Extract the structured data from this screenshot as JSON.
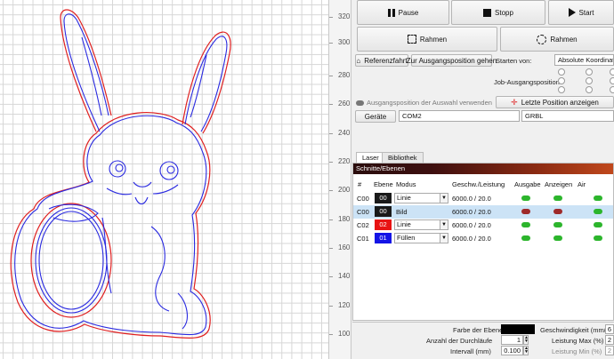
{
  "toolbar": {
    "pause_label": "Pause",
    "stop_label": "Stopp",
    "start_label": "Start",
    "frame_label": "Rahmen",
    "frame_round_label": "Rahmen"
  },
  "position": {
    "reference_label": "Referenzfahrt",
    "home_label": "Zur Ausgangsposition gehen",
    "start_from_label": "Starten von:",
    "start_from_value": "Absolute Koordinaten",
    "job_origin_label": "Job-Ausgangsposition",
    "use_selection_label": "Ausgangsposition der Auswahl verwenden",
    "last_position_label": "Letzte Position anzeigen",
    "device_button_label": "Geräte",
    "port_value": "COM2",
    "controller_value": "GRBL"
  },
  "ruler": {
    "ticks": [
      "320",
      "300",
      "280",
      "260",
      "240",
      "220",
      "200",
      "180",
      "160",
      "140",
      "120",
      "100"
    ]
  },
  "tabs": [
    {
      "label": "Laser"
    },
    {
      "label": "Bibliothek"
    }
  ],
  "layers": {
    "title": "Schnitte/Ebenen",
    "headers": {
      "num": "#",
      "layer": "Ebene",
      "mode": "Modus",
      "speed_power": "Geschw./Leistung",
      "output": "Ausgabe",
      "show": "Anzeigen",
      "air": "Air"
    },
    "rows": [
      {
        "num": "C00",
        "layer": "00",
        "color": "#1a1a1a",
        "mode": "Linie",
        "has_dropdown": true,
        "speed_power": "6000.0 / 20.0",
        "output": true,
        "show": true,
        "air": true
      },
      {
        "num": "C00",
        "layer": "00",
        "color": "#1a1a1a",
        "mode": "Bild",
        "has_dropdown": false,
        "speed_power": "6000.0 / 20.0",
        "output": false,
        "show": false,
        "air": true
      },
      {
        "num": "C02",
        "layer": "02",
        "color": "#e81313",
        "mode": "Linie",
        "has_dropdown": true,
        "speed_power": "6000.0 / 20.0",
        "output": true,
        "show": true,
        "air": true
      },
      {
        "num": "C01",
        "layer": "01",
        "color": "#1414e6",
        "mode": "Füllen",
        "has_dropdown": true,
        "speed_power": "6000.0 / 20.0",
        "output": true,
        "show": true,
        "air": true
      }
    ]
  },
  "settings": {
    "layer_color_label": "Farbe der Ebene",
    "layer_color": "#000000",
    "passes_label": "Anzahl der Durchläufe",
    "passes_value": "1",
    "interval_label": "Intervall (mm)",
    "interval_value": "0.100",
    "speed_label": "Geschwindigkeit (mm/m)",
    "power_max_label": "Leistung Max (%)",
    "power_min_label": "Leistung Min (%)",
    "speed_value_partial": "6",
    "power_max_partial": "2",
    "power_min_partial": "2"
  }
}
